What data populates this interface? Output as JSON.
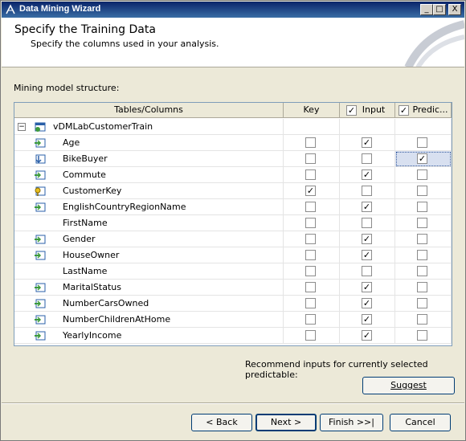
{
  "window": {
    "title": "Data Mining Wizard",
    "min_glyph": "_",
    "max_glyph": "□",
    "close_glyph": "X"
  },
  "header": {
    "title": "Specify the Training Data",
    "subtitle": "Specify the columns used in your analysis."
  },
  "structure_label": "Mining model structure:",
  "grid": {
    "columns": {
      "name": "Tables/Columns",
      "key": "Key",
      "input": "Input",
      "predict": "Predic..."
    },
    "header_input_checked": true,
    "header_predict_checked": true,
    "table": {
      "name": "vDMLabCustomerTrain",
      "expanded_glyph": "−"
    },
    "rows": [
      {
        "name": "Age",
        "icon": "input-column-icon",
        "key": false,
        "input": true,
        "predict": false
      },
      {
        "name": "BikeBuyer",
        "icon": "predict-column-icon",
        "key": false,
        "input": false,
        "predict": true,
        "selected": true
      },
      {
        "name": "Commute",
        "icon": "input-column-icon",
        "key": false,
        "input": true,
        "predict": false
      },
      {
        "name": "CustomerKey",
        "icon": "key-column-icon",
        "key": true,
        "input": false,
        "predict": false
      },
      {
        "name": "EnglishCountryRegionName",
        "icon": "input-column-icon",
        "key": false,
        "input": true,
        "predict": false
      },
      {
        "name": "FirstName",
        "icon": "",
        "key": false,
        "input": false,
        "predict": false
      },
      {
        "name": "Gender",
        "icon": "input-column-icon",
        "key": false,
        "input": true,
        "predict": false
      },
      {
        "name": "HouseOwner",
        "icon": "input-column-icon",
        "key": false,
        "input": true,
        "predict": false
      },
      {
        "name": "LastName",
        "icon": "",
        "key": false,
        "input": false,
        "predict": false
      },
      {
        "name": "MaritalStatus",
        "icon": "input-column-icon",
        "key": false,
        "input": true,
        "predict": false
      },
      {
        "name": "NumberCarsOwned",
        "icon": "input-column-icon",
        "key": false,
        "input": true,
        "predict": false
      },
      {
        "name": "NumberChildrenAtHome",
        "icon": "input-column-icon",
        "key": false,
        "input": true,
        "predict": false
      },
      {
        "name": "YearlyIncome",
        "icon": "input-column-icon",
        "key": false,
        "input": true,
        "predict": false
      }
    ]
  },
  "recommend_label": "Recommend inputs for currently selected predictable:",
  "buttons": {
    "suggest": "Suggest",
    "back": "< Back",
    "next": "Next >",
    "finish": "Finish >>|",
    "cancel": "Cancel"
  },
  "colors": {
    "title_bar": "#0a246a",
    "selection": "#d8e0f0",
    "dialog_bg": "#ece9d8"
  }
}
